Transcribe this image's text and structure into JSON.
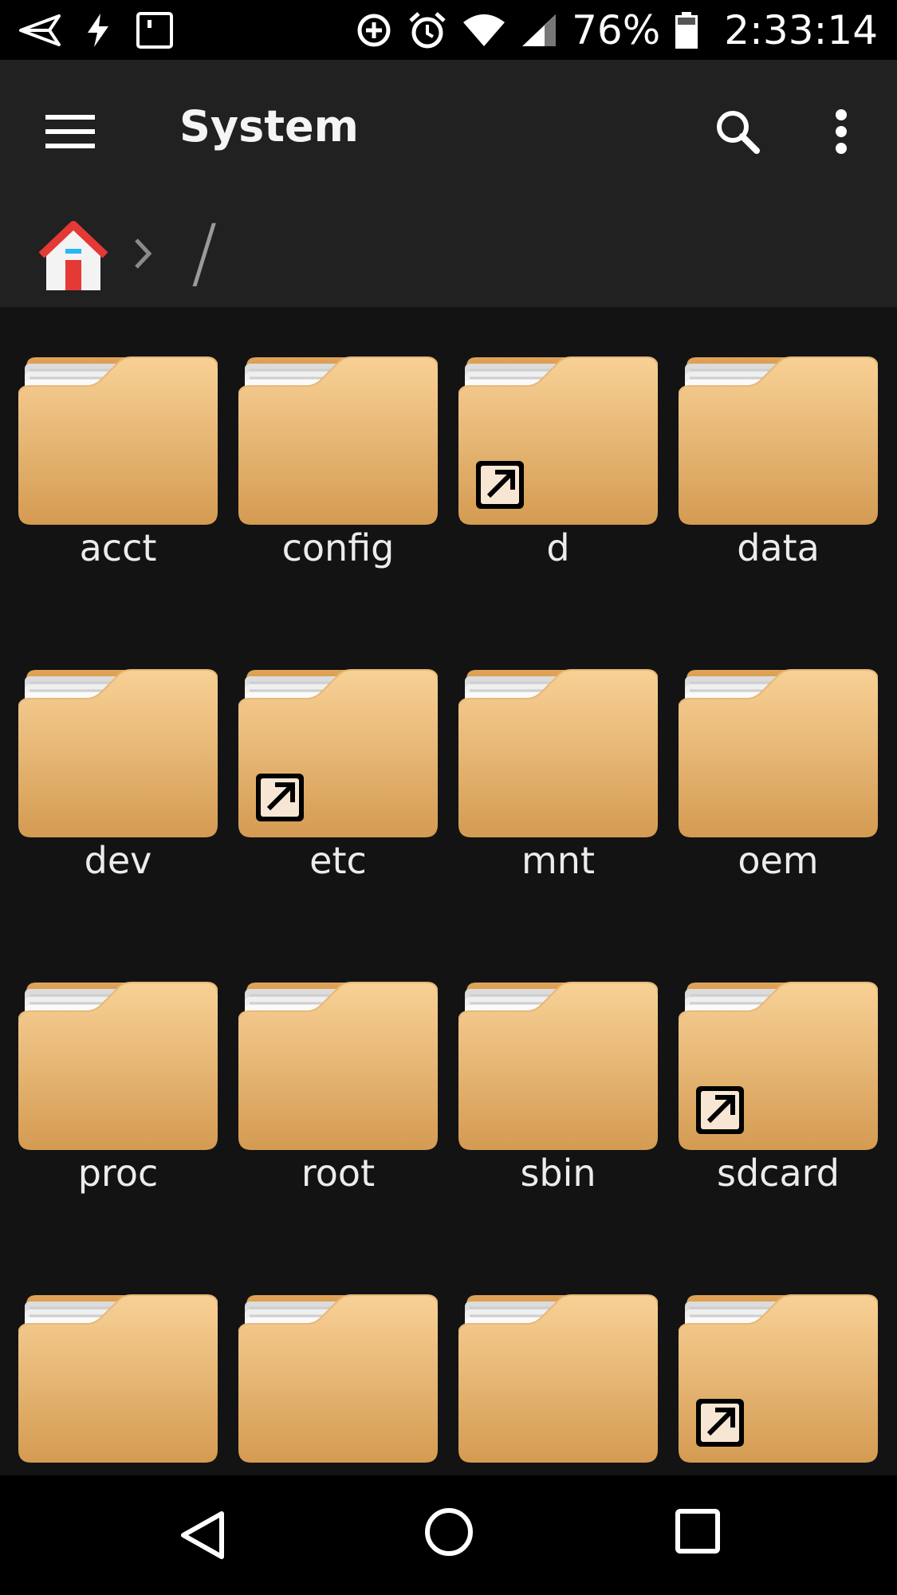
{
  "status_bar": {
    "battery": "76%",
    "time": "2:33:14",
    "icons": [
      "send-icon",
      "flash-icon",
      "screen-icon",
      "data-saver-icon",
      "alarm-icon",
      "wifi-icon",
      "signal-icon",
      "battery-icon"
    ]
  },
  "app_bar": {
    "title": "System",
    "icons": [
      "menu-icon",
      "search-icon",
      "more-vert-icon"
    ]
  },
  "breadcrumb": {
    "home_icon": "home-icon",
    "path": "/"
  },
  "folders": [
    {
      "name": "acct",
      "shortcut": false
    },
    {
      "name": "config",
      "shortcut": false
    },
    {
      "name": "d",
      "shortcut": true
    },
    {
      "name": "data",
      "shortcut": false
    },
    {
      "name": "dev",
      "shortcut": false
    },
    {
      "name": "etc",
      "shortcut": true
    },
    {
      "name": "mnt",
      "shortcut": false
    },
    {
      "name": "oem",
      "shortcut": false
    },
    {
      "name": "proc",
      "shortcut": false
    },
    {
      "name": "root",
      "shortcut": false
    },
    {
      "name": "sbin",
      "shortcut": false
    },
    {
      "name": "sdcard",
      "shortcut": true
    },
    {
      "name": "",
      "shortcut": false
    },
    {
      "name": "",
      "shortcut": false
    },
    {
      "name": "",
      "shortcut": false
    },
    {
      "name": "",
      "shortcut": true
    }
  ],
  "nav_bar": {
    "icons": [
      "back-icon",
      "home-nav-icon",
      "recents-icon"
    ]
  },
  "colors": {
    "background": "#131313",
    "app_bar": "#212121",
    "folder_top": "#f6cc8e",
    "folder_bottom": "#d49b52"
  }
}
